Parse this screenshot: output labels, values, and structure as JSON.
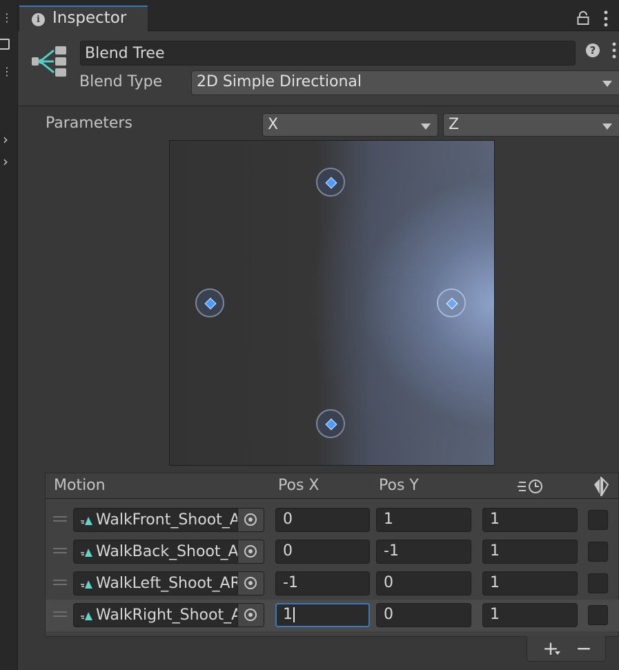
{
  "tab": {
    "title": "Inspector"
  },
  "header": {
    "name": "Blend Tree",
    "blend_type_label": "Blend Type",
    "blend_type_value": "2D Simple Directional"
  },
  "parameters": {
    "label": "Parameters",
    "x": "X",
    "y": "Z"
  },
  "graph": {
    "nodes": [
      {
        "motion": "WalkFront_Shoot_AR",
        "pos_x": 0,
        "pos_y": 1,
        "active": false
      },
      {
        "motion": "WalkBack_Shoot_AR",
        "pos_x": 0,
        "pos_y": -1,
        "active": false
      },
      {
        "motion": "WalkLeft_Shoot_AR",
        "pos_x": -1,
        "pos_y": 0,
        "active": false
      },
      {
        "motion": "WalkRight_Shoot_AR",
        "pos_x": 1,
        "pos_y": 0,
        "active": true
      }
    ]
  },
  "list": {
    "headers": {
      "motion": "Motion",
      "pos_x": "Pos X",
      "pos_y": "Pos Y"
    },
    "rows": [
      {
        "motion": "WalkFront_Shoot_A",
        "pos_x": "0",
        "pos_y": "1",
        "speed": "1"
      },
      {
        "motion": "WalkBack_Shoot_A",
        "pos_x": "0",
        "pos_y": "-1",
        "speed": "1"
      },
      {
        "motion": "WalkLeft_Shoot_AR",
        "pos_x": "-1",
        "pos_y": "0",
        "speed": "1"
      },
      {
        "motion": "WalkRight_Shoot_A",
        "pos_x": "1",
        "pos_y": "0",
        "speed": "1"
      }
    ]
  },
  "footer": {
    "add_label": "+",
    "remove_label": "−"
  },
  "colors": {
    "accent": "#3a79bb",
    "node_fill": "#4d9bff",
    "clip_icon": "#5fd4c8"
  }
}
